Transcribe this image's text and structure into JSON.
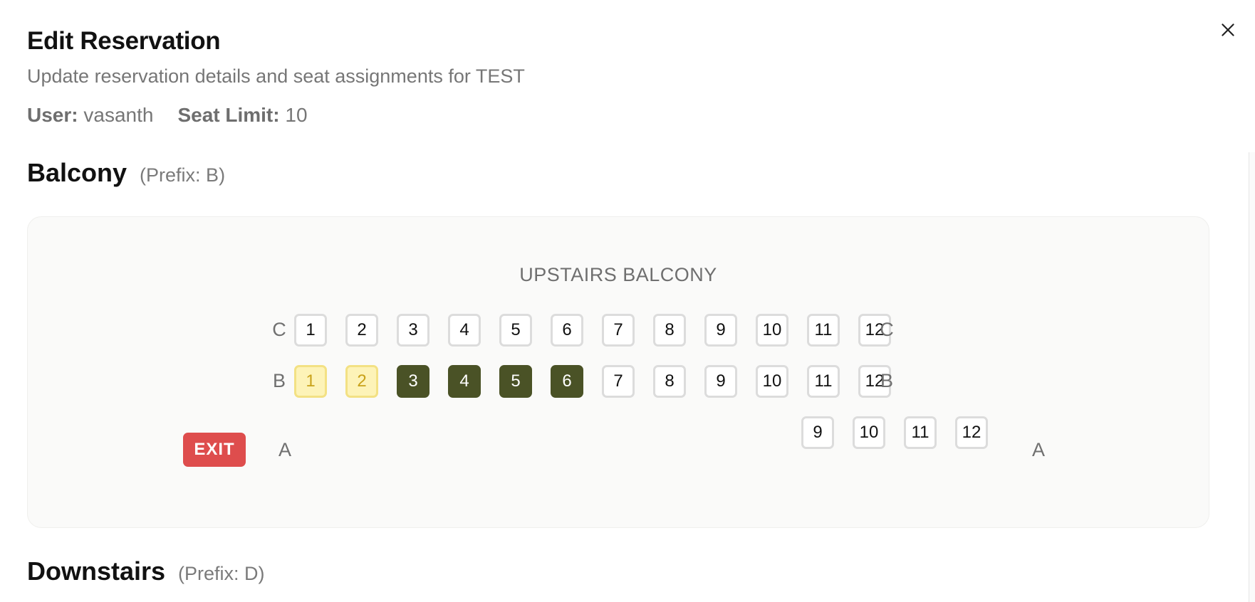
{
  "dialog": {
    "title": "Edit Reservation",
    "subtitle": "Update reservation details and seat assignments for TEST",
    "user_label": "User:",
    "user_value": "vasanth",
    "seat_limit_label": "Seat Limit:",
    "seat_limit_value": "10",
    "close_icon": "close-icon"
  },
  "sections": [
    {
      "name": "Balcony",
      "prefix": "(Prefix: B)",
      "stage_label": "UPSTAIRS BALCONY",
      "exit_label": "EXIT",
      "rows": [
        {
          "label": "C",
          "seats": [
            {
              "n": "1",
              "state": "available"
            },
            {
              "n": "2",
              "state": "available"
            },
            {
              "n": "3",
              "state": "available"
            },
            {
              "n": "4",
              "state": "available"
            },
            {
              "n": "5",
              "state": "available"
            },
            {
              "n": "6",
              "state": "available"
            },
            {
              "n": "7",
              "state": "available"
            },
            {
              "n": "8",
              "state": "available"
            },
            {
              "n": "9",
              "state": "available"
            },
            {
              "n": "10",
              "state": "available"
            },
            {
              "n": "11",
              "state": "available"
            },
            {
              "n": "12",
              "state": "available"
            }
          ]
        },
        {
          "label": "B",
          "seats": [
            {
              "n": "1",
              "state": "pending"
            },
            {
              "n": "2",
              "state": "pending"
            },
            {
              "n": "3",
              "state": "reserved"
            },
            {
              "n": "4",
              "state": "reserved"
            },
            {
              "n": "5",
              "state": "reserved"
            },
            {
              "n": "6",
              "state": "reserved"
            },
            {
              "n": "7",
              "state": "available"
            },
            {
              "n": "8",
              "state": "available"
            },
            {
              "n": "9",
              "state": "available"
            },
            {
              "n": "10",
              "state": "available"
            },
            {
              "n": "11",
              "state": "available"
            },
            {
              "n": "12",
              "state": "available"
            }
          ]
        },
        {
          "label": "A",
          "seats": [
            {
              "n": "9",
              "state": "available"
            },
            {
              "n": "10",
              "state": "available"
            },
            {
              "n": "11",
              "state": "available"
            },
            {
              "n": "12",
              "state": "available"
            }
          ]
        }
      ]
    },
    {
      "name": "Downstairs",
      "prefix": "(Prefix: D)"
    }
  ],
  "colors": {
    "available": "#ffffff",
    "pending": "#fdf3b8",
    "reserved": "#4a5226",
    "exit": "#de4d4d"
  }
}
